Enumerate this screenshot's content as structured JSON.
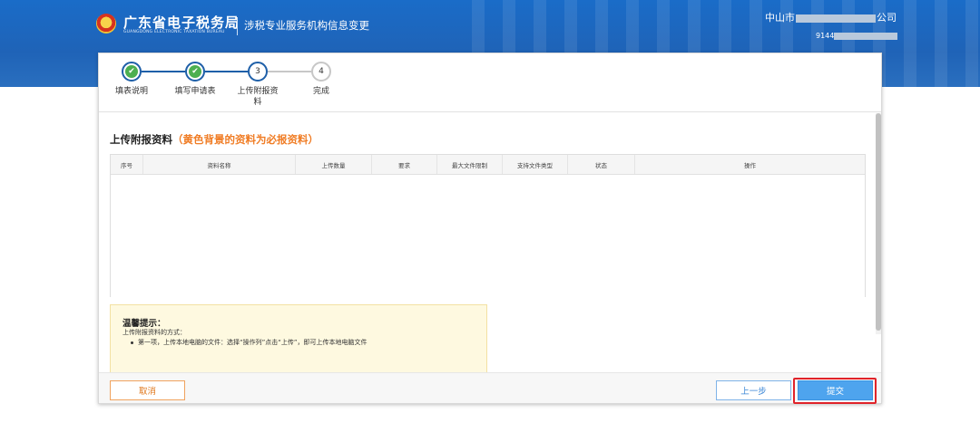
{
  "header": {
    "brand_cn": "广东省电子税务局",
    "brand_en": "GUANGDONG ELECTRONIC TAXATION BUREAU",
    "page_title": "涉税专业服务机构信息变更",
    "company_prefix": "中山市",
    "company_suffix": "公司",
    "taxid_prefix": "9144"
  },
  "stepper": {
    "steps": [
      {
        "number": "1",
        "label": "填表说明",
        "state": "done"
      },
      {
        "number": "2",
        "label": "填写申请表",
        "state": "done"
      },
      {
        "number": "3",
        "label": "上传附报资料",
        "state": "current"
      },
      {
        "number": "4",
        "label": "完成",
        "state": "todo"
      }
    ]
  },
  "section": {
    "title": "上传附报资料",
    "note": "（黄色背景的资料为必报资料）"
  },
  "table": {
    "columns": [
      "序号",
      "资料名称",
      "上传数量",
      "要求",
      "最大文件限制",
      "支持文件类型",
      "状态",
      "操作"
    ],
    "rows": []
  },
  "tip": {
    "title": "温馨提示：",
    "line": "上传附报资料的方式：",
    "bullet": "第一项，上传本地电脑的文件：选择“操作列”点击“上传”，即可上传本地电脑文件"
  },
  "footer": {
    "cancel_label": "取消",
    "prev_label": "上一步",
    "submit_label": "提交"
  },
  "colors": {
    "header_blue": "#1f63b7",
    "step_blue": "#1e5fa8",
    "note_orange": "#f07c24",
    "submit_blue": "#4ea4ee",
    "highlight_red": "#e0232a",
    "tip_bg": "#fef9e0"
  }
}
